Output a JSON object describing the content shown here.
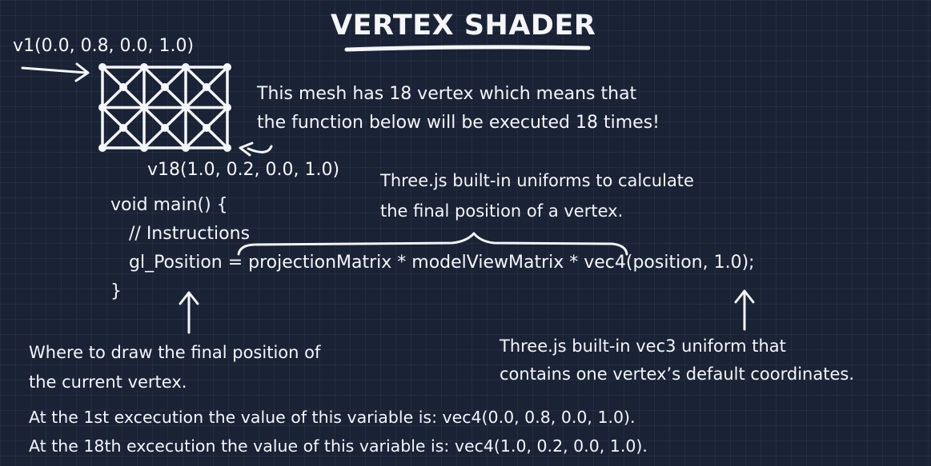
{
  "title": "VERTEX SHADER",
  "labels": {
    "v1": "v1(0.0, 0.8, 0.0, 1.0)",
    "v18": "v18(1.0, 0.2, 0.0, 1.0)"
  },
  "mesh_note": {
    "line1": "This mesh has 18 vertex which means that",
    "line2": "the function below will be executed 18 times!"
  },
  "uniforms_note": {
    "line1": "Three.js built-in uniforms to calculate",
    "line2": "the final position of a vertex."
  },
  "code": {
    "line1": "void main() {",
    "line2": "// Instructions",
    "line3": "gl_Position = projectionMatrix * modelViewMatrix * vec4(position, 1.0);",
    "line4": "}"
  },
  "gl_position_note": {
    "line1": "Where to draw the final position of",
    "line2": "the current vertex."
  },
  "position_note": {
    "line1": "Three.js built-in vec3 uniform that",
    "line2": "contains one vertex’s default coordinates."
  },
  "execution_notes": {
    "first": "At the 1st excecution the value of this variable is: vec4(0.0, 0.8, 0.0, 1.0).",
    "last": "At the 18th excecution the value of this variable is: vec4(1.0, 0.2, 0.0, 1.0)."
  },
  "colors": {
    "background": "#1a2236",
    "ink": "#f4f6fa"
  }
}
